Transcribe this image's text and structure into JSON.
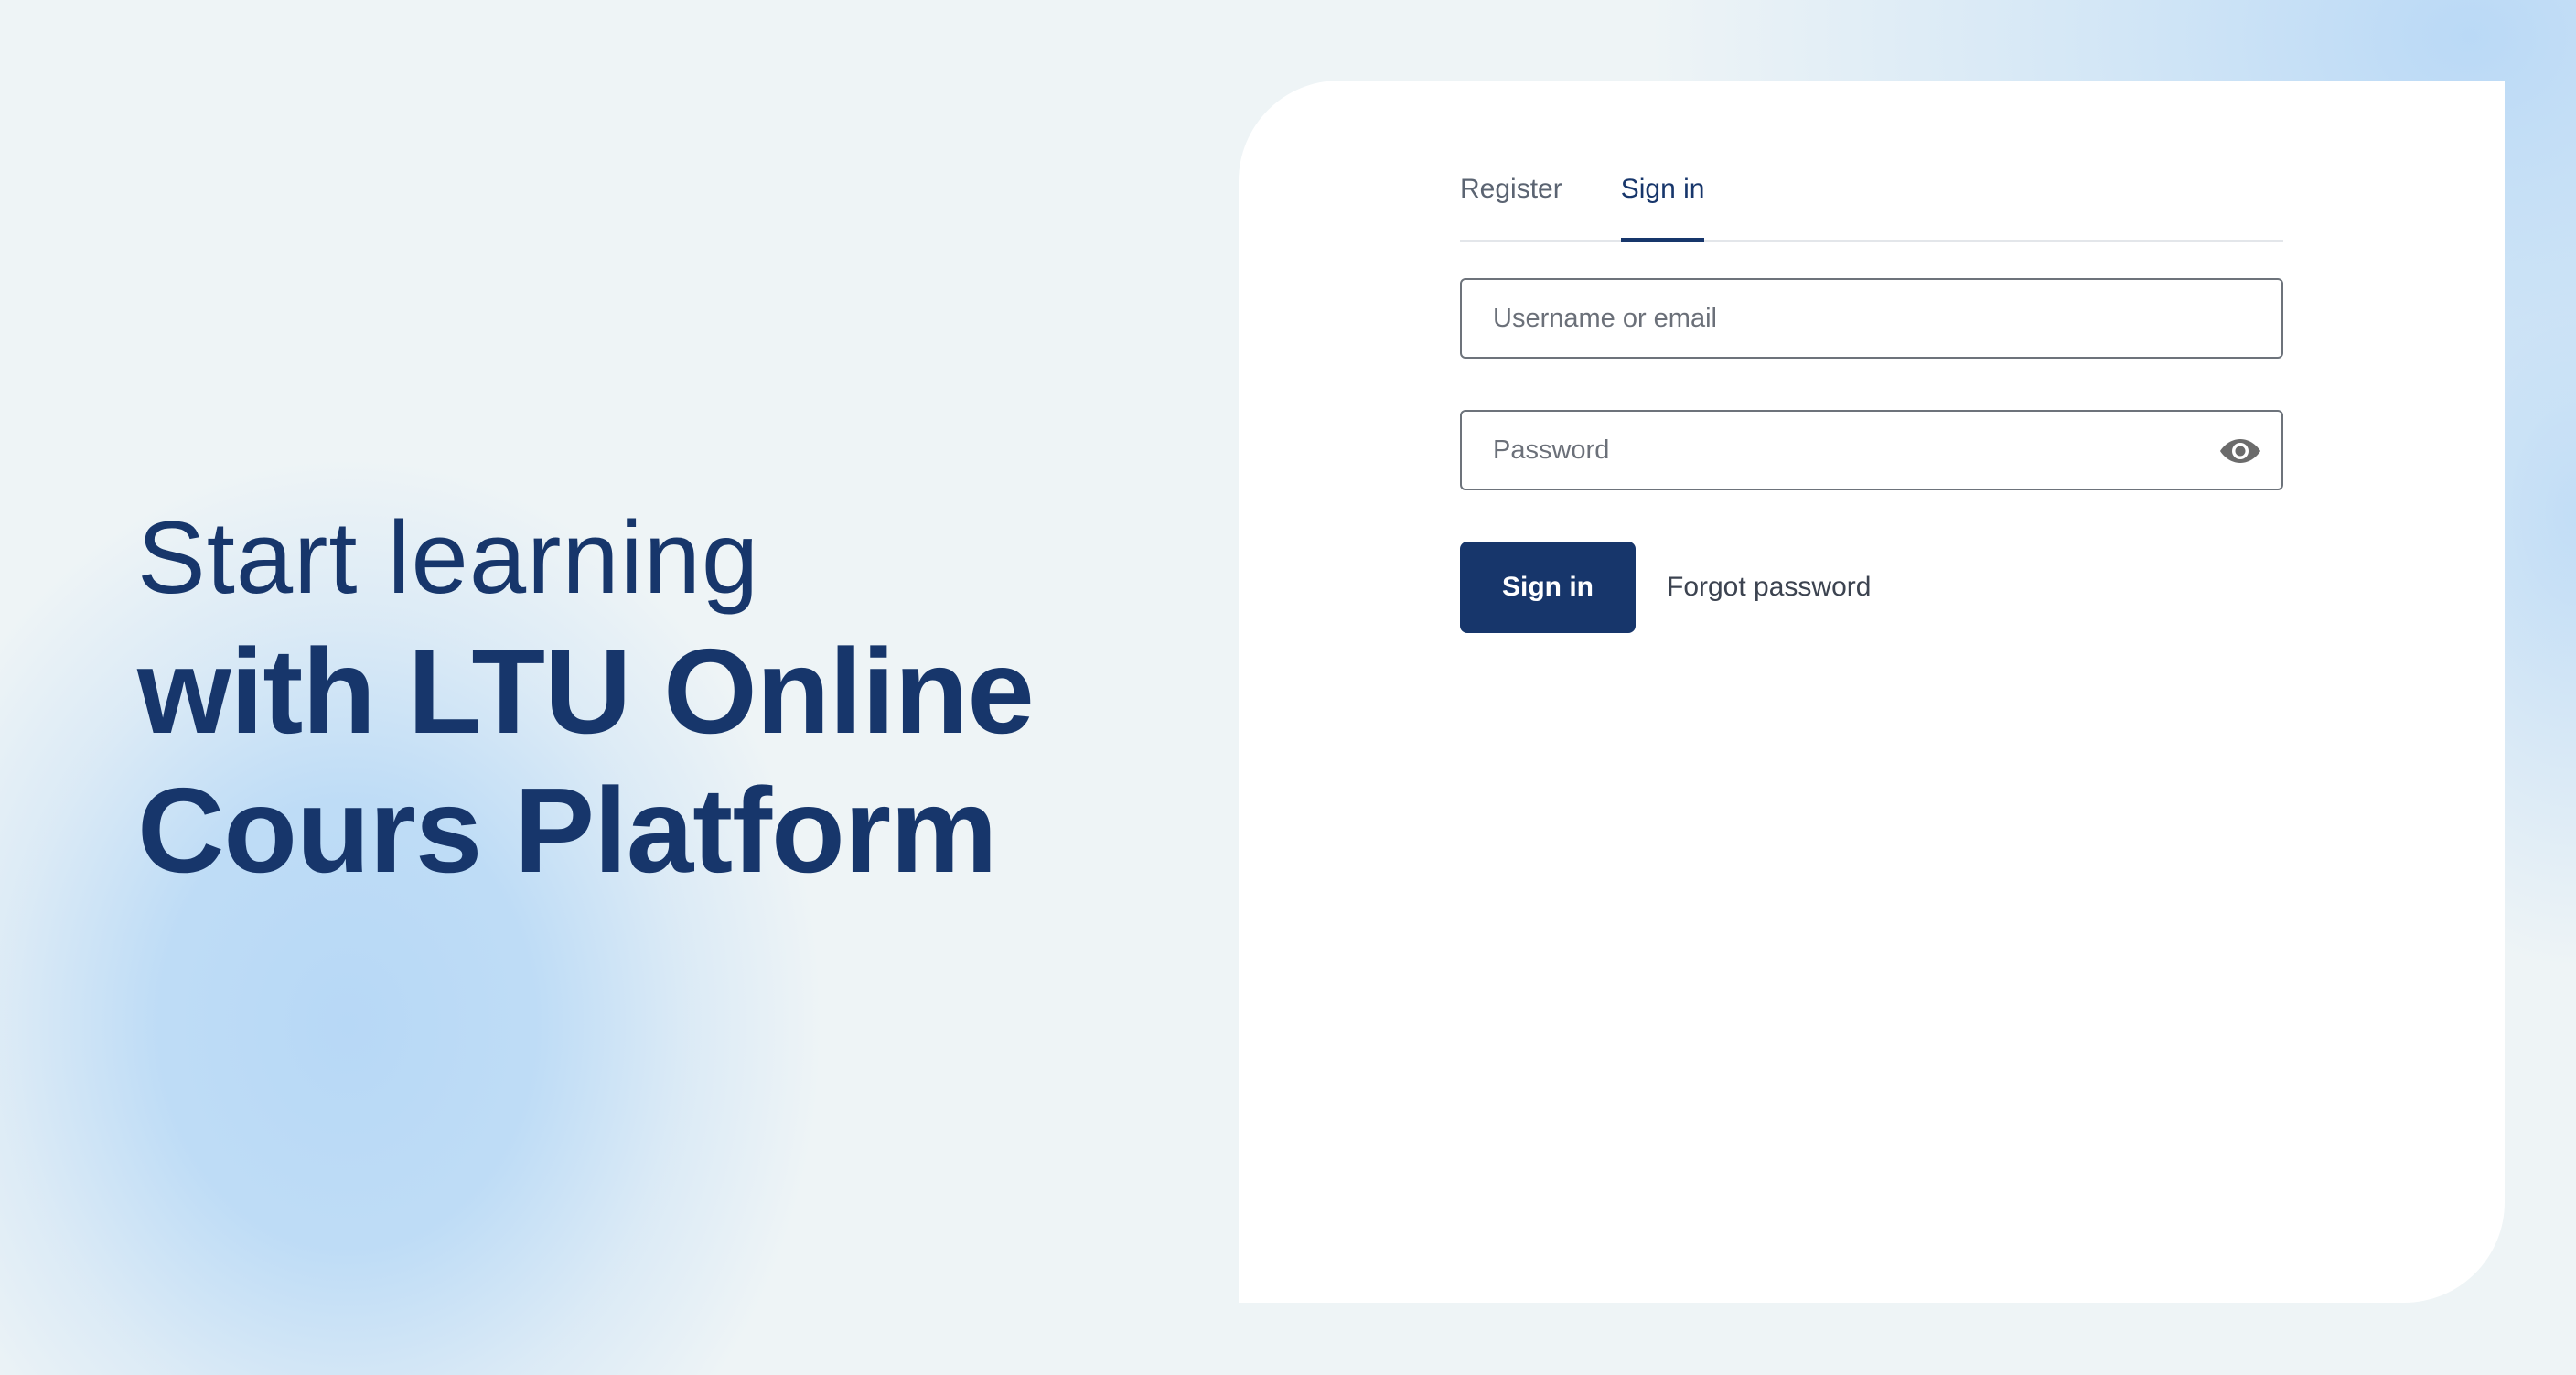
{
  "hero": {
    "line1": "Start learning",
    "line2": "with LTU Online",
    "line3": "Cours Platform"
  },
  "tabs": [
    {
      "label": "Register",
      "active": false
    },
    {
      "label": "Sign in",
      "active": true
    }
  ],
  "form": {
    "username_placeholder": "Username or email",
    "username_value": "",
    "password_placeholder": "Password",
    "password_value": "",
    "password_toggle_icon": "eye-icon",
    "submit_label": "Sign in",
    "forgot_label": "Forgot password"
  },
  "colors": {
    "brand": "#17366b",
    "background": "#eef4f6",
    "accent_gradient": "#b7d8f6",
    "card": "#ffffff"
  }
}
